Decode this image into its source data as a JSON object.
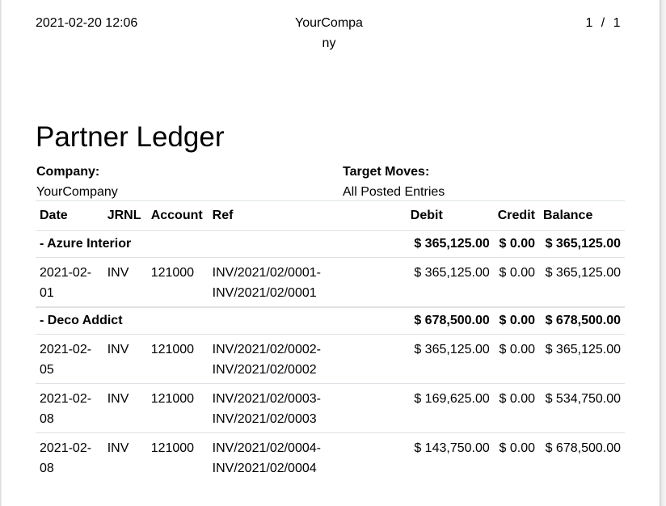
{
  "header": {
    "printed_at": "2021-02-20 12:06",
    "company": "YourCompany",
    "page_current": "1",
    "page_separator": "/",
    "page_total": "1"
  },
  "report": {
    "title": "Partner Ledger",
    "company_label": "Company:",
    "company_value": "YourCompany",
    "target_moves_label": "Target Moves:",
    "target_moves_value": "All Posted Entries"
  },
  "table": {
    "columns": [
      "Date",
      "JRNL",
      "Account",
      "Ref",
      "Debit",
      "Credit",
      "Balance"
    ],
    "partners": [
      {
        "name": "- Azure Interior",
        "debit": "$ 365,125.00",
        "credit": "$ 0.00",
        "balance": "$ 365,125.00",
        "lines": [
          {
            "date": "2021-02-01",
            "jrnl": "INV",
            "account": "121000",
            "ref": "INV/2021/02/0001-INV/2021/02/0001",
            "debit": "$ 365,125.00",
            "credit": "$ 0.00",
            "balance": "$ 365,125.00"
          }
        ]
      },
      {
        "name": "- Deco Addict",
        "debit": "$ 678,500.00",
        "credit": "$ 0.00",
        "balance": "$ 678,500.00",
        "lines": [
          {
            "date": "2021-02-05",
            "jrnl": "INV",
            "account": "121000",
            "ref": "INV/2021/02/0002-INV/2021/02/0002",
            "debit": "$ 365,125.00",
            "credit": "$ 0.00",
            "balance": "$ 365,125.00"
          },
          {
            "date": "2021-02-08",
            "jrnl": "INV",
            "account": "121000",
            "ref": "INV/2021/02/0003-INV/2021/02/0003",
            "debit": "$ 169,625.00",
            "credit": "$ 0.00",
            "balance": "$ 534,750.00"
          },
          {
            "date": "2021-02-08",
            "jrnl": "INV",
            "account": "121000",
            "ref": "INV/2021/02/0004-INV/2021/02/0004",
            "debit": "$ 143,750.00",
            "credit": "$ 0.00",
            "balance": "$ 678,500.00"
          }
        ]
      }
    ]
  }
}
